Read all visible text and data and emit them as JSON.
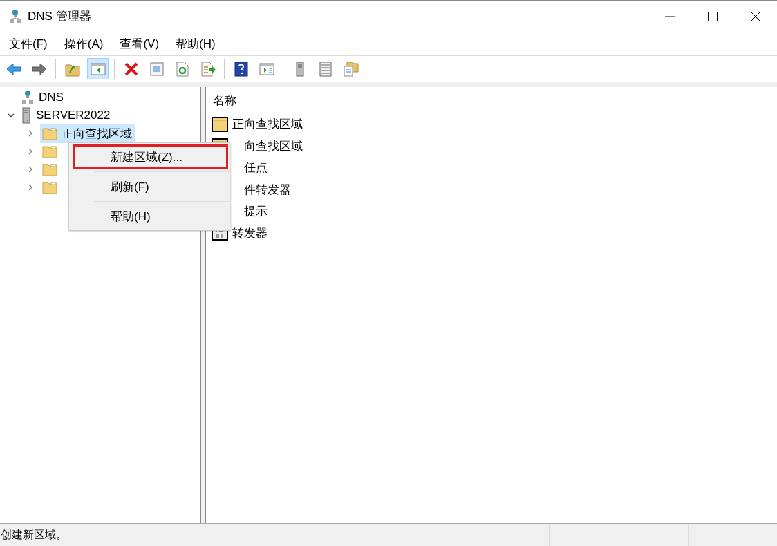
{
  "window": {
    "title": "DNS 管理器"
  },
  "menu_bar": [
    "文件(F)",
    "操作(A)",
    "查看(V)",
    "帮助(H)"
  ],
  "toolbar": [
    {
      "kind": "back",
      "pressed": false
    },
    {
      "kind": "forward",
      "pressed": false
    },
    {
      "kind": "separator"
    },
    {
      "kind": "up",
      "pressed": false
    },
    {
      "kind": "tree",
      "pressed": true
    },
    {
      "kind": "separator"
    },
    {
      "kind": "delete",
      "pressed": false
    },
    {
      "kind": "properties",
      "pressed": false
    },
    {
      "kind": "refresh",
      "pressed": false
    },
    {
      "kind": "export",
      "pressed": false
    },
    {
      "kind": "separator"
    },
    {
      "kind": "help",
      "pressed": false
    },
    {
      "kind": "action",
      "pressed": false
    },
    {
      "kind": "separator"
    },
    {
      "kind": "server",
      "pressed": false
    },
    {
      "kind": "list",
      "pressed": false
    },
    {
      "kind": "folders",
      "pressed": false
    }
  ],
  "tree": [
    {
      "label": "DNS",
      "kind": "dns",
      "children": [
        {
          "label": "SERVER2022",
          "kind": "server",
          "expanded": true,
          "children": [
            {
              "label": "正向查找区域",
              "kind": "folder",
              "expanded": false,
              "selected": true
            },
            {
              "kind": "folder",
              "expanded": false,
              "selected": false
            },
            {
              "kind": "folder",
              "expanded": false,
              "selected": false
            },
            {
              "kind": "folder",
              "expanded": false,
              "selected": false
            }
          ]
        }
      ]
    }
  ],
  "list": {
    "columns": [
      "名称"
    ],
    "rows": [
      {
        "name": "正向查找区域",
        "kind": "folder",
        "clipped": false
      },
      {
        "name": "向查找区域",
        "kind": "folder",
        "clipped": true
      },
      {
        "name": "任点",
        "clipped": true
      },
      {
        "name": "件转发器",
        "clipped": true
      },
      {
        "name": "提示",
        "clipped": true
      },
      {
        "name": "转发器",
        "kind": "binary",
        "clipped": false
      }
    ]
  },
  "context_menu": [
    {
      "label": "新建区域(Z)...",
      "marked": true
    },
    {
      "label": "刷新(F)",
      "marked": false
    },
    {
      "label": "帮助(H)",
      "marked": false
    }
  ],
  "status_bar": {
    "text": "创建新区域。"
  }
}
